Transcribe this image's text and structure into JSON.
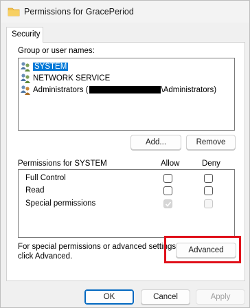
{
  "window": {
    "title": "Permissions for GracePeriod"
  },
  "tabs": [
    {
      "label": "Security",
      "selected": true
    }
  ],
  "groups": {
    "label": "Group or user names:",
    "items": [
      {
        "name": "SYSTEM",
        "selected": true
      },
      {
        "name": "NETWORK SERVICE",
        "selected": false
      },
      {
        "name_prefix": "Administrators (",
        "name_suffix": "\\Administrators)",
        "redacted": true,
        "selected": false
      }
    ]
  },
  "buttons": {
    "add": "Add...",
    "remove": "Remove",
    "advanced": "Advanced",
    "ok": "OK",
    "cancel": "Cancel",
    "apply": "Apply"
  },
  "permissions": {
    "header": "Permissions for SYSTEM",
    "allow_label": "Allow",
    "deny_label": "Deny",
    "rows": [
      {
        "name": "Full Control",
        "allow": false,
        "deny": false
      },
      {
        "name": "Read",
        "allow": false,
        "deny": false
      },
      {
        "name": "Special permissions",
        "allow": true,
        "allow_disabled": true,
        "deny": false,
        "deny_disabled": true
      }
    ]
  },
  "advanced_hint": {
    "line1": "For special permissions or advanced settings,",
    "line2": "click Advanced."
  },
  "colors": {
    "selection": "#0078d7",
    "highlight": "#e0101a",
    "default_button_border": "#0067c0"
  }
}
